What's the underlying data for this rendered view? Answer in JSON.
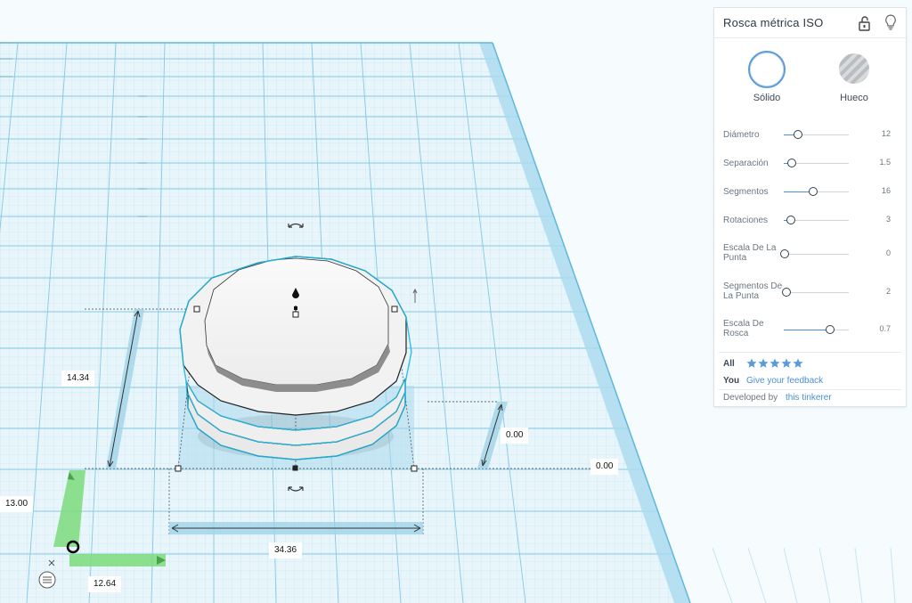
{
  "panel": {
    "title": "Rosca métrica ISO",
    "lock_icon": "unlock-icon",
    "bulb_icon": "lightbulb-icon",
    "types": [
      {
        "label": "Sólido",
        "icon": "solid-circle-icon",
        "selected": true
      },
      {
        "label": "Hueco",
        "icon": "hole-striped-circle-icon",
        "selected": false
      }
    ],
    "properties": [
      {
        "label": "Diámetro",
        "value": "12",
        "fraction": 0.2
      },
      {
        "label": "Separación",
        "value": "1.5",
        "fraction": 0.11
      },
      {
        "label": "Segmentos",
        "value": "16",
        "fraction": 0.44
      },
      {
        "label": "Rotaciones",
        "value": "3",
        "fraction": 0.1
      },
      {
        "label": "Escala De La Punta",
        "value": "0",
        "fraction": 0.0
      },
      {
        "label": "Segmentos De La Punta",
        "value": "2",
        "fraction": 0.03
      },
      {
        "label": "Escala De Rosca",
        "value": "0.7",
        "fraction": 0.7
      }
    ],
    "rating": {
      "all_label": "All",
      "stars": 5,
      "you_label": "You",
      "feedback_link": "Give your feedback"
    },
    "developer": {
      "label": "Developed by",
      "link": "this tinkerer"
    }
  },
  "workplane": {
    "dimensions": {
      "width": "34.36",
      "depth": "34.36",
      "height": "14.34",
      "elevation": "0.00",
      "origin_y": "13.00",
      "origin_x": "12.64"
    },
    "icons": [
      "rotate-arrow-icon",
      "drop-pin-icon",
      "axis-x-icon",
      "layers-icon"
    ],
    "colors": {
      "grid": "#9fd3e8",
      "grid_major": "#7bc3df",
      "selection": "#1fb8e0",
      "shape_fill": "#ececec",
      "ruler_green": "#7ddb7d"
    }
  }
}
